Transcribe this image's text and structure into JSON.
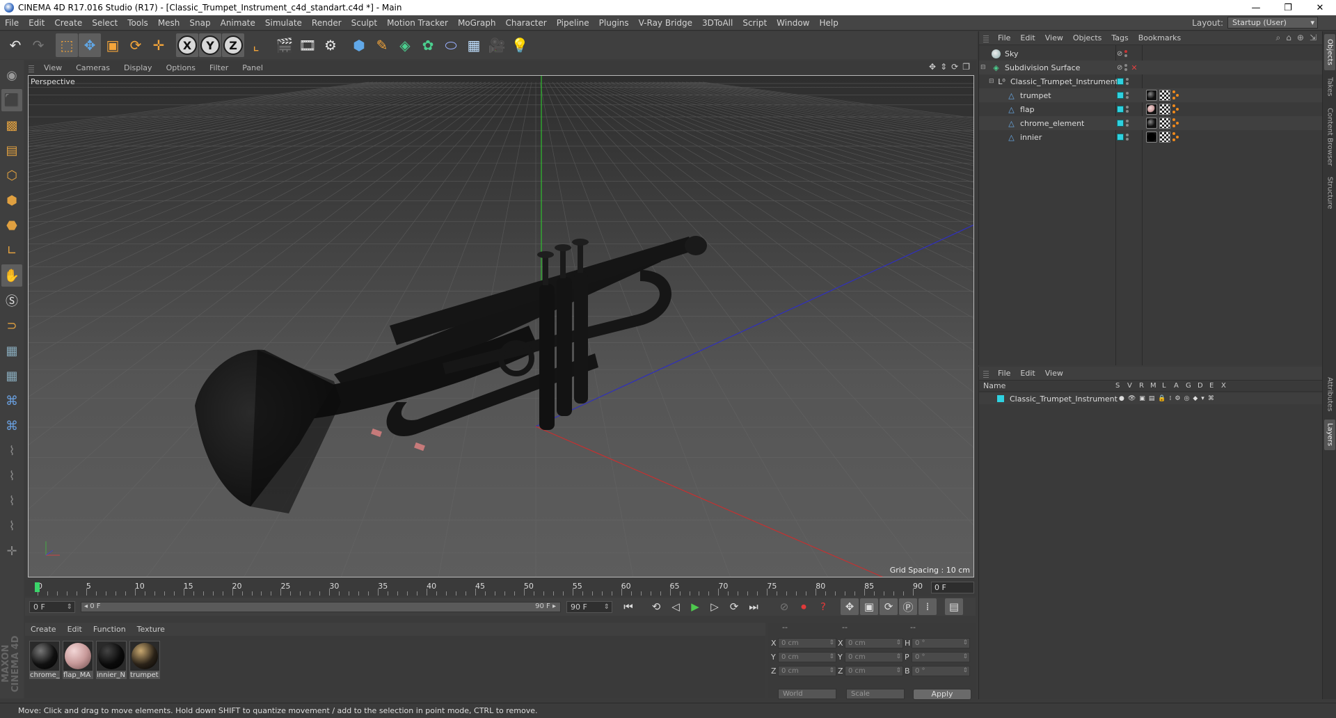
{
  "window": {
    "title": "CINEMA 4D R17.016 Studio (R17) - [Classic_Trumpet_Instrument_c4d_standart.c4d *] - Main",
    "minimize": "—",
    "maximize": "❐",
    "close": "✕"
  },
  "menu": [
    "File",
    "Edit",
    "Create",
    "Select",
    "Tools",
    "Mesh",
    "Snap",
    "Animate",
    "Simulate",
    "Render",
    "Sculpt",
    "Motion Tracker",
    "MoGraph",
    "Character",
    "Pipeline",
    "Plugins",
    "V-Ray Bridge",
    "3DToAll",
    "Script",
    "Window",
    "Help"
  ],
  "layout": {
    "label": "Layout:",
    "value": "Startup (User)"
  },
  "toolbar": {
    "axis_x": "X",
    "axis_y": "Y",
    "axis_z": "Z"
  },
  "viewport": {
    "menu": [
      "View",
      "Cameras",
      "Display",
      "Options",
      "Filter",
      "Panel"
    ],
    "label": "Perspective",
    "grid_spacing": "Grid Spacing : 10 cm"
  },
  "timeline": {
    "labels": [
      "0",
      "5",
      "10",
      "15",
      "20",
      "25",
      "30",
      "35",
      "40",
      "45",
      "50",
      "55",
      "60",
      "65",
      "70",
      "75",
      "80",
      "85",
      "90"
    ],
    "current_frame": "0 F",
    "start_field": "0 F",
    "range_start": "◂ 0 F",
    "range_end": "90 F ▸",
    "end_field": "90 F"
  },
  "materials": {
    "menu": [
      "Create",
      "Edit",
      "Function",
      "Texture"
    ],
    "items": [
      {
        "name": "chrome_",
        "color": "#101010"
      },
      {
        "name": "flap_MA",
        "color": "#c89a9a"
      },
      {
        "name": "innier_N",
        "color": "#0a0a0a"
      },
      {
        "name": "trumpet",
        "color": "#2a2218"
      }
    ]
  },
  "coords": {
    "headers": [
      "--",
      "--",
      "--"
    ],
    "rows": [
      {
        "a1": "X",
        "v1": "0 cm",
        "a2": "X",
        "v2": "0 cm",
        "a3": "H",
        "v3": "0 °"
      },
      {
        "a1": "Y",
        "v1": "0 cm",
        "a2": "Y",
        "v2": "0 cm",
        "a3": "P",
        "v3": "0 °"
      },
      {
        "a1": "Z",
        "v1": "0 cm",
        "a2": "Z",
        "v2": "0 cm",
        "a3": "B",
        "v3": "0 °"
      }
    ],
    "world": "World",
    "scale": "Scale",
    "apply": "Apply"
  },
  "status": "Move: Click and drag to move elements. Hold down SHIFT to quantize movement / add to the selection in point mode, CTRL to remove.",
  "objects": {
    "menu": [
      "File",
      "Edit",
      "View",
      "Objects",
      "Tags",
      "Bookmarks"
    ],
    "items": [
      {
        "name": "Sky"
      },
      {
        "name": "Subdivision Surface"
      },
      {
        "name": "Classic_Trumpet_Instrument"
      },
      {
        "name": "trumpet"
      },
      {
        "name": "flap"
      },
      {
        "name": "chrome_element"
      },
      {
        "name": "innier"
      }
    ]
  },
  "layers": {
    "menu": [
      "File",
      "Edit",
      "View"
    ],
    "columns": {
      "name": "Name",
      "flags": [
        "S",
        "V",
        "R",
        "M",
        "L",
        "A",
        "G",
        "D",
        "E",
        "X"
      ]
    },
    "items": [
      {
        "name": "Classic_Trumpet_Instrument"
      }
    ]
  },
  "side_tabs": [
    "Objects",
    "Takes",
    "Content Browser",
    "Structure",
    "Attributes",
    "Layers"
  ],
  "colors": {
    "accent_cyan": "#2fd1e0",
    "play_green": "#4ec94e",
    "record_red": "#e03a3a",
    "tool_orange": "#f4a53a"
  }
}
